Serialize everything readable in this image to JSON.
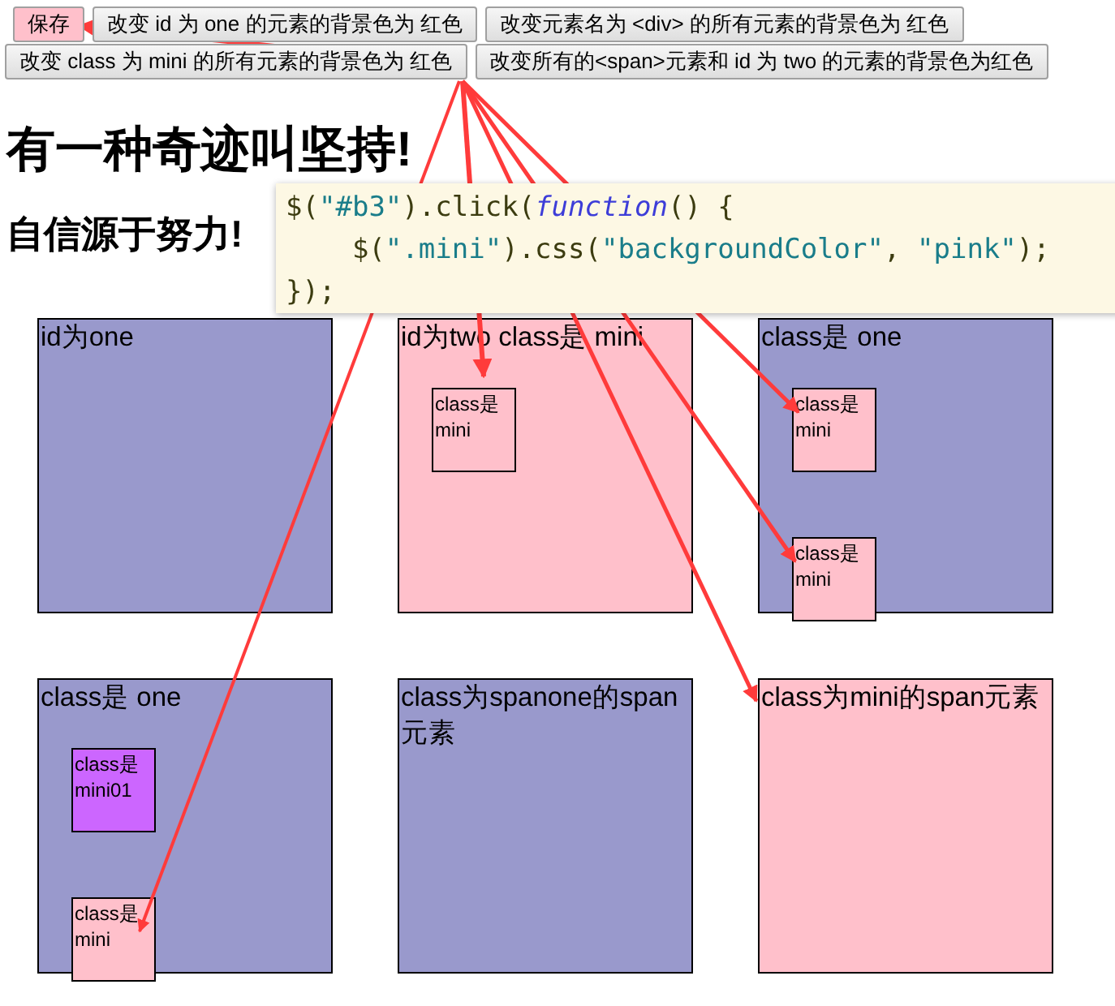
{
  "button_rows": [
    [
      {
        "label": "保存",
        "highlighted": true
      },
      {
        "label": "改变 id 为 one 的元素的背景色为 红色",
        "highlighted": false
      },
      {
        "label": "改变元素名为 <div> 的所有元素的背景色为 红色",
        "highlighted": false
      }
    ],
    [
      {
        "label": "改变 class 为 mini 的所有元素的背景色为 红色",
        "highlighted": false
      },
      {
        "label": "改变所有的<span>元素和 id 为 two 的元素的背景色为红色",
        "highlighted": false
      }
    ]
  ],
  "heading": "有一种奇迹叫坚持!",
  "subheading": "自信源于努力!",
  "code_lines": [
    [
      {
        "kind": "plain",
        "text": "$("
      },
      {
        "kind": "string",
        "text": "\"#b3\""
      },
      {
        "kind": "plain",
        "text": ").click("
      },
      {
        "kind": "keyword",
        "text": "function"
      },
      {
        "kind": "plain",
        "text": "() {"
      }
    ],
    [
      {
        "kind": "plain",
        "text": "    $("
      },
      {
        "kind": "string",
        "text": "\".mini\""
      },
      {
        "kind": "plain",
        "text": ").css("
      },
      {
        "kind": "string",
        "text": "\"backgroundColor\""
      },
      {
        "kind": "plain",
        "text": ", "
      },
      {
        "kind": "string",
        "text": "\"pink\""
      },
      {
        "kind": "plain",
        "text": ");"
      }
    ],
    [
      {
        "kind": "plain",
        "text": "});"
      }
    ]
  ],
  "boxes": [
    {
      "label": "id为one",
      "color": "#9999cc"
    },
    {
      "label": "id为two class是 mini",
      "color": "#ffc0cb",
      "children": [
        {
          "label": "class是mini",
          "color": "#ffc0cb"
        }
      ]
    },
    {
      "label": "class是 one",
      "color": "#9999cc",
      "children": [
        {
          "label": "class是mini",
          "color": "#ffc0cb"
        },
        {
          "label": "class是mini",
          "color": "#ffc0cb"
        }
      ]
    },
    {
      "label": "class是 one",
      "color": "#9999cc",
      "children": [
        {
          "label": "class是mini01",
          "color": "#cc66ff"
        },
        {
          "label": "class是mini",
          "color": "#ffc0cb"
        }
      ]
    },
    {
      "label": "class为spanone的span元素",
      "color": "#9999cc"
    },
    {
      "label": "class为mini的span元素",
      "color": "#ffc0cb"
    }
  ]
}
